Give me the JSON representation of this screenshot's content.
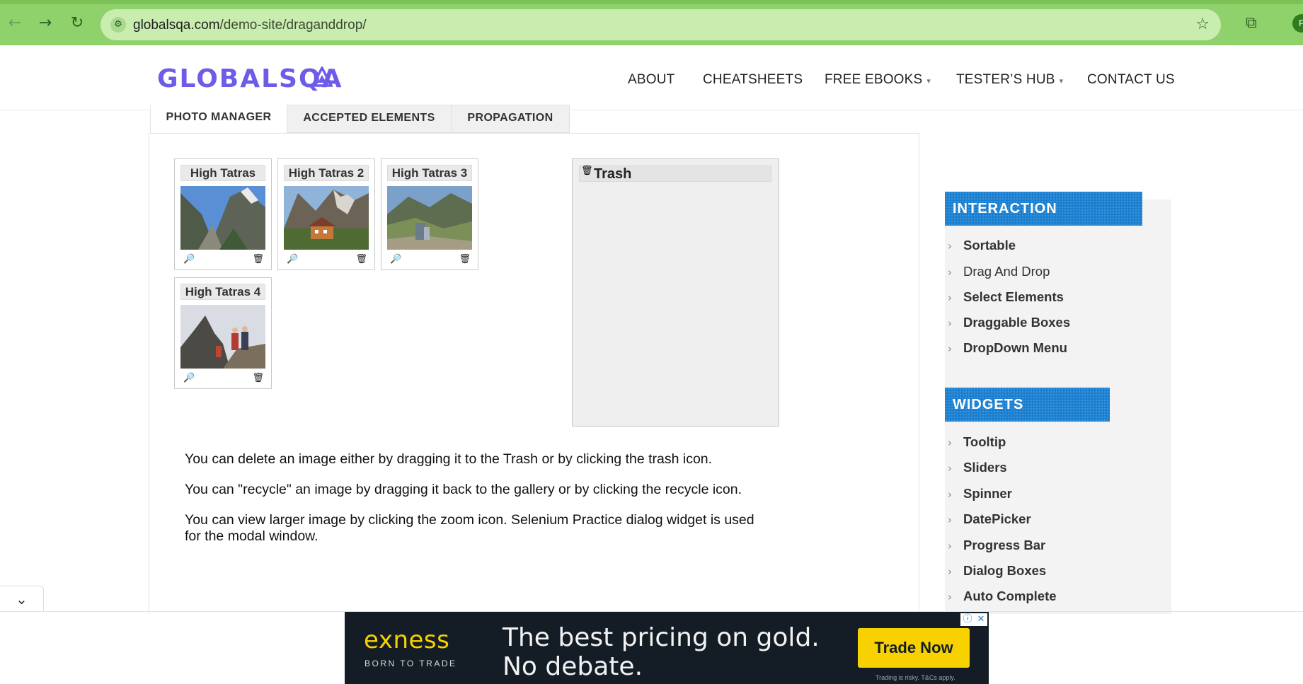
{
  "browser": {
    "url_domain": "globalsqa.com",
    "url_path": "/demo-site/draganddrop/",
    "profile_initial": "F",
    "icons": [
      "back-icon",
      "forward-icon",
      "reload-icon",
      "site-info-icon",
      "bookmark-star-icon",
      "extensions-icon"
    ]
  },
  "header": {
    "logo_text": "GLOBALSQA",
    "nav": [
      "ABOUT",
      "CHEATSHEETS",
      "FREE EBOOKS",
      "TESTER’S HUB",
      "CONTACT US"
    ],
    "brand_color": "#6c5ce7"
  },
  "tabs": [
    "PHOTO MANAGER",
    "ACCEPTED ELEMENTS",
    "PROPAGATION"
  ],
  "gallery": {
    "items": [
      {
        "title": "High Tatras"
      },
      {
        "title": "High Tatras 2"
      },
      {
        "title": "High Tatras 3"
      },
      {
        "title": "High Tatras 4"
      }
    ],
    "icons": [
      "zoom-icon",
      "trash-icon"
    ]
  },
  "trash": {
    "title": "Trash"
  },
  "paragraphs": [
    "You can delete an image either by dragging it to the Trash or by clicking the trash icon.",
    "You can \"recycle\" an image by dragging it back to the gallery or by clicking the recycle icon.",
    "You can view larger image by clicking the zoom icon. Selenium Practice dialog widget is used for the modal window."
  ],
  "sidebar": {
    "accent_color": "#1a7fd0",
    "interaction_title": "INTERACTION",
    "interaction_links": [
      "Sortable",
      "Drag And Drop",
      "Select Elements",
      "Draggable Boxes",
      "DropDown Menu"
    ],
    "widgets_title": "WIDGETS",
    "widgets_links": [
      "Tooltip",
      "Sliders",
      "Spinner",
      "DatePicker",
      "Progress Bar",
      "Dialog Boxes",
      "Auto Complete"
    ]
  },
  "ad": {
    "brand": "exness",
    "tagline": "BORN TO TRADE",
    "headline_1": "The best pricing on gold.",
    "headline_2": "No debate.",
    "cta": "Trade Now",
    "disclaimer": "Trading is risky. T&Cs apply.",
    "brand_color": "#f7d100"
  }
}
